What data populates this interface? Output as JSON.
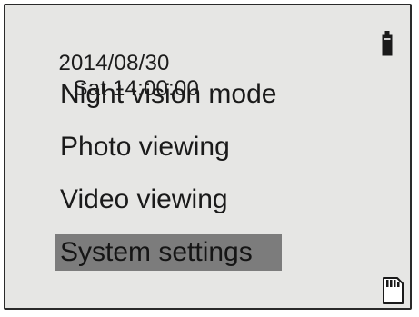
{
  "status": {
    "date": "2014/08/30",
    "time": "Sat 14:00:00",
    "battery_icon": "battery-icon",
    "storage_icon": "sd-card-icon"
  },
  "menu": {
    "items": [
      {
        "label": "Night vision mode",
        "selected": false
      },
      {
        "label": "Photo viewing",
        "selected": false
      },
      {
        "label": "Video viewing",
        "selected": false
      },
      {
        "label": "System settings",
        "selected": true
      }
    ]
  },
  "colors": {
    "screen_background": "#e6e6e4",
    "selection_highlight": "#7c7c7c",
    "text": "#1a1a1a"
  }
}
